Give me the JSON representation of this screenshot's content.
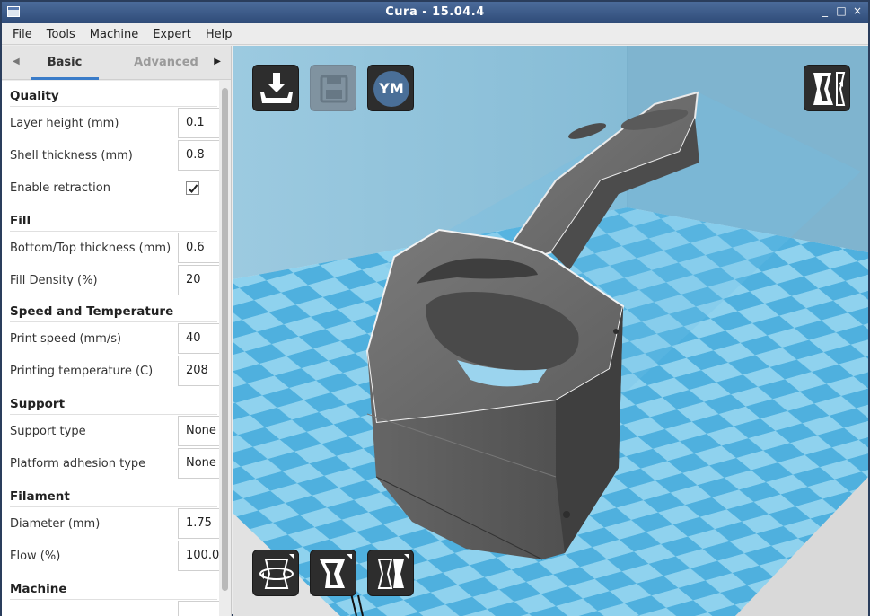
{
  "window": {
    "title": "Cura - 15.04.4",
    "controls": [
      "_",
      "□",
      "×"
    ]
  },
  "menubar": [
    "File",
    "Tools",
    "Machine",
    "Expert",
    "Help"
  ],
  "tabs": {
    "basic": "Basic",
    "advanced": "Advanced"
  },
  "sections": {
    "quality": "Quality",
    "fill": "Fill",
    "speed": "Speed and Temperature",
    "support": "Support",
    "filament": "Filament",
    "machine": "Machine"
  },
  "fields": {
    "layer_height": {
      "label": "Layer height (mm)",
      "value": "0.1"
    },
    "shell_thickness": {
      "label": "Shell thickness (mm)",
      "value": "0.8"
    },
    "enable_retraction": {
      "label": "Enable retraction",
      "checked": true
    },
    "bottom_top_thickness": {
      "label": "Bottom/Top thickness (mm)",
      "value": "0.6"
    },
    "fill_density": {
      "label": "Fill Density (%)",
      "value": "20"
    },
    "print_speed": {
      "label": "Print speed (mm/s)",
      "value": "40"
    },
    "printing_temperature": {
      "label": "Printing temperature (C)",
      "value": "208"
    },
    "support_type": {
      "label": "Support type",
      "value": "None"
    },
    "platform_adhesion": {
      "label": "Platform adhesion type",
      "value": "None"
    },
    "diameter": {
      "label": "Diameter (mm)",
      "value": "1.75"
    },
    "flow": {
      "label": "Flow (%)",
      "value": "100.0"
    }
  },
  "viewport": {
    "ym_label": "YM",
    "icons": [
      "load-model-icon",
      "save-toolpath-icon",
      "youmagine-icon",
      "view-mode-icon",
      "rotate-icon",
      "scale-icon",
      "mirror-icon"
    ]
  },
  "colors": {
    "titlebar": "#34507d",
    "platform_light": "#8fd0ec",
    "platform_dark": "#4faedc",
    "model": "#5a5a5a",
    "tab_accent": "#3a7cc9"
  }
}
